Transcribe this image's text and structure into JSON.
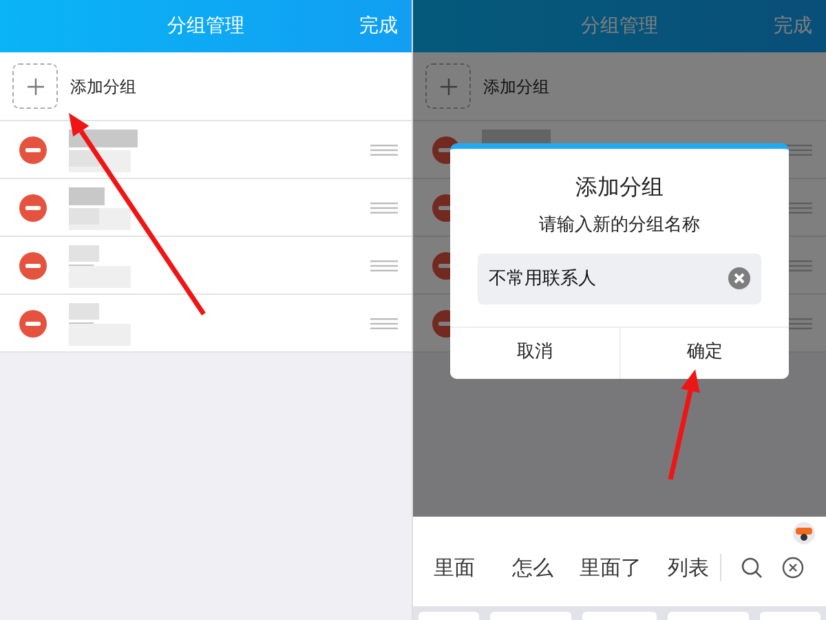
{
  "screens": [
    {
      "dimmed": false,
      "arrow": true,
      "header": {
        "title": "分组管理",
        "done": "完成"
      },
      "add_label": "添加分组",
      "groups": [
        {
          "kind": "pixelated"
        },
        {
          "kind": "pixelated"
        },
        {
          "kind": "pixelated"
        },
        {
          "kind": "pixelated"
        }
      ]
    },
    {
      "dimmed": true,
      "arrow": true,
      "header": {
        "title": "分组管理",
        "done": "完成"
      },
      "add_label": "添加分组",
      "groups": [
        {
          "kind": "pixelated"
        },
        {
          "kind": "covered"
        },
        {
          "kind": "covered"
        },
        {
          "kind": "covered"
        }
      ],
      "dialog": {
        "title": "添加分组",
        "message": "请输入新的分组名称",
        "value": "不常用联系人",
        "buttons": [
          "取消",
          "确定"
        ]
      },
      "keyboard": {
        "candidates": [
          "里面",
          "怎么",
          "里面了",
          "列表"
        ]
      }
    }
  ]
}
